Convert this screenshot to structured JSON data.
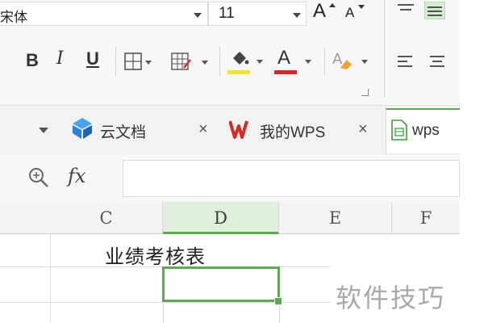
{
  "ribbon": {
    "font_name": "宋体",
    "font_size": "11",
    "grow_font": "A",
    "shrink_font": "A",
    "bold": "B",
    "italic": "I",
    "underline": "U",
    "font_color_glyph": "A"
  },
  "colors": {
    "highlight": "#f0e632",
    "font_color": "#d9262c",
    "selection_green": "#5fa655",
    "wps_red": "#d52a2a",
    "cloud_blue": "#2f80d8"
  },
  "tabs": [
    {
      "label": "云文档",
      "icon": "cloud-doc-icon"
    },
    {
      "label": "我的WPS",
      "icon": "wps-logo-icon"
    },
    {
      "label": "wps",
      "icon": "spreadsheet-file-icon"
    }
  ],
  "tab_close": "×",
  "formula_bar": {
    "fx_label": "fx",
    "value": ""
  },
  "columns": [
    {
      "label": "C",
      "selected": false
    },
    {
      "label": "D",
      "selected": true
    },
    {
      "label": "E",
      "selected": false
    },
    {
      "label": "F",
      "selected": false
    }
  ],
  "sheet": {
    "title": "业绩考核表"
  },
  "watermark": "软件技巧"
}
